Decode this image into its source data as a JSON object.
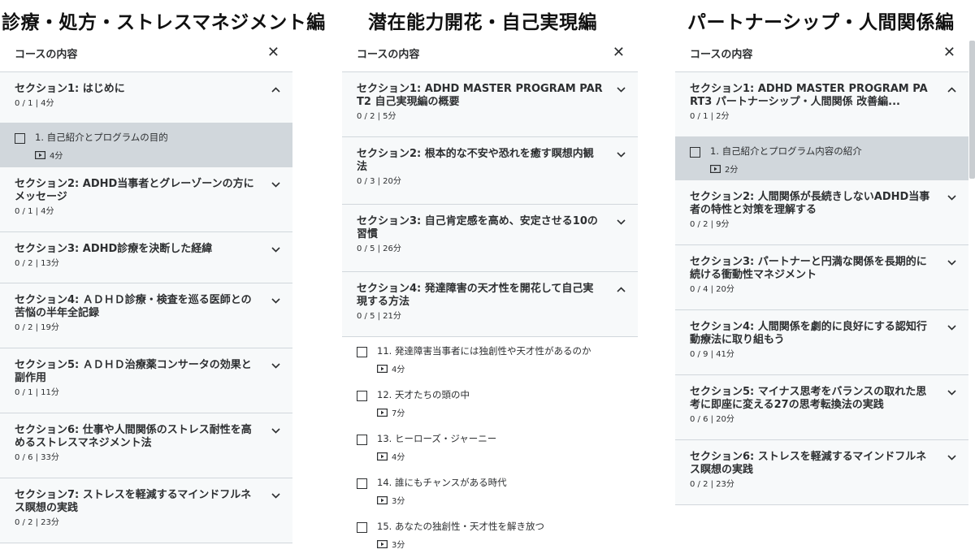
{
  "columns": [
    {
      "heading": "診療・処方・ストレスマネジメント編",
      "panel_title": "コースの内容",
      "sections": [
        {
          "title": "セクション1: はじめに",
          "meta": "0 / 1 | 4分",
          "expanded": true,
          "lessons": [
            {
              "title": "1. 自己紹介とプログラムの目的",
              "duration": "4分",
              "active": true
            }
          ]
        },
        {
          "title": "セクション2: ADHD当事者とグレーゾーンの方にメッセージ",
          "meta": "0 / 1 | 4分",
          "expanded": false
        },
        {
          "title": "セクション3: ADHD診療を決断した経緯",
          "meta": "0 / 2 | 13分",
          "expanded": false
        },
        {
          "title": "セクション4: ＡＤＨＤ診療・検査を巡る医師との苦悩の半年全記録",
          "meta": "0 / 2 | 19分",
          "expanded": false
        },
        {
          "title": "セクション5: ＡＤＨＤ治療薬コンサータの効果と副作用",
          "meta": "0 / 1 | 11分",
          "expanded": false
        },
        {
          "title": "セクション6: 仕事や人間関係のストレス耐性を高めるストレスマネジメント法",
          "meta": "0 / 6 | 33分",
          "expanded": false
        },
        {
          "title": "セクション7: ストレスを軽減するマインドフルネス瞑想の実践",
          "meta": "0 / 2 | 23分",
          "expanded": false
        }
      ]
    },
    {
      "heading": "潜在能力開花・自己実現編",
      "panel_title": "コースの内容",
      "sections": [
        {
          "title": "セクション1: ADHD MASTER PROGRAM PART2 自己実現編の概要",
          "meta": "0 / 2 | 5分",
          "expanded": false
        },
        {
          "title": "セクション2: 根本的な不安や恐れを癒す瞑想内観法",
          "meta": "0 / 3 | 20分",
          "expanded": false
        },
        {
          "title": "セクション3: 自己肯定感を高め、安定させる10の習慣",
          "meta": "0 / 5 | 26分",
          "expanded": false
        },
        {
          "title": "セクション4: 発達障害の天才性を開花して自己実現する方法",
          "meta": "0 / 5 | 21分",
          "expanded": true,
          "lessons": [
            {
              "title": "11. 発達障害当事者には独創性や天才性があるのか",
              "duration": "4分",
              "active": false
            },
            {
              "title": "12. 天才たちの頭の中",
              "duration": "7分",
              "active": false
            },
            {
              "title": "13. ヒーローズ・ジャーニー",
              "duration": "4分",
              "active": false
            },
            {
              "title": "14. 誰にもチャンスがある時代",
              "duration": "3分",
              "active": false
            },
            {
              "title": "15. あなたの独創性・天才性を解き放つ",
              "duration": "3分",
              "active": false
            }
          ]
        }
      ]
    },
    {
      "heading": "パートナーシップ・人間関係編",
      "panel_title": "コースの内容",
      "sections": [
        {
          "title": "セクション1: ADHD MASTER PROGRAM PART3 パートナーシップ・人間関係 改善編...",
          "meta": "0 / 1 | 2分",
          "expanded": true,
          "lessons": [
            {
              "title": "1. 自己紹介とプログラム内容の紹介",
              "duration": "2分",
              "active": true
            }
          ]
        },
        {
          "title": "セクション2: 人間関係が長続きしないADHD当事者の特性と対策を理解する",
          "meta": "0 / 2 | 9分",
          "expanded": false
        },
        {
          "title": "セクション3: パートナーと円満な関係を長期的に続ける衝動性マネジメント",
          "meta": "0 / 4 | 20分",
          "expanded": false
        },
        {
          "title": "セクション4: 人間関係を劇的に良好にする認知行動療法に取り組もう",
          "meta": "0 / 9 | 41分",
          "expanded": false
        },
        {
          "title": "セクション5: マイナス思考をバランスの取れた思考に即座に変える27の思考転換法の実践",
          "meta": "0 / 6 | 20分",
          "expanded": false
        },
        {
          "title": "セクション6: ストレスを軽減するマインドフルネス瞑想の実践",
          "meta": "0 / 2 | 23分",
          "expanded": false
        }
      ]
    }
  ],
  "icons": {
    "close": "close-icon",
    "expand": "chevron-down-icon",
    "collapse": "chevron-up-icon",
    "video": "video-play-icon",
    "checkbox": "checkbox-icon"
  },
  "colors": {
    "panel_bg": "#f7f9fa",
    "active_lesson_bg": "#d1d7dc",
    "border": "#d1d7dc",
    "text": "#2d2f31"
  }
}
